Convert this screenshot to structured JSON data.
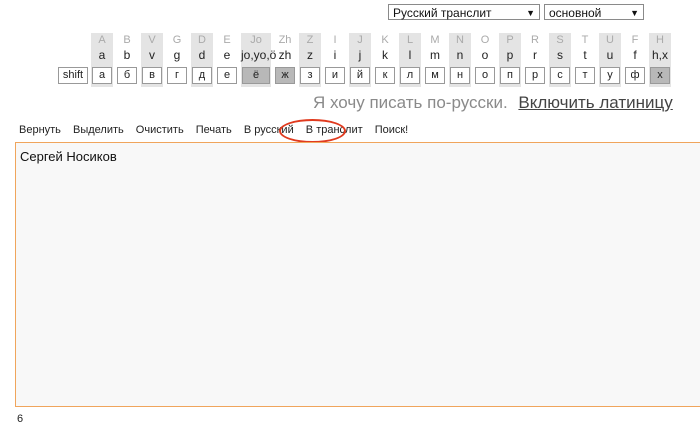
{
  "selects": {
    "mode": "Русский транслит",
    "layout": "основной"
  },
  "keyboard": {
    "columns": [
      {
        "upper": "A",
        "lower": "a",
        "key": "а",
        "shaded": true
      },
      {
        "upper": "B",
        "lower": "b",
        "key": "б",
        "shaded": false
      },
      {
        "upper": "V",
        "lower": "v",
        "key": "в",
        "shaded": true
      },
      {
        "upper": "G",
        "lower": "g",
        "key": "г",
        "shaded": false
      },
      {
        "upper": "D",
        "lower": "d",
        "key": "д",
        "shaded": true
      },
      {
        "upper": "E",
        "lower": "e",
        "key": "е",
        "shaded": false
      },
      {
        "upper": "Jo",
        "lower": "jo,yo,ö",
        "key": "ё",
        "shaded": true,
        "active": true,
        "wide": true
      },
      {
        "upper": "Zh",
        "lower": "zh",
        "key": "ж",
        "shaded": false,
        "active": true
      },
      {
        "upper": "Z",
        "lower": "z",
        "key": "з",
        "shaded": true
      },
      {
        "upper": "I",
        "lower": "i",
        "key": "и",
        "shaded": false
      },
      {
        "upper": "J",
        "lower": "j",
        "key": "й",
        "shaded": true
      },
      {
        "upper": "K",
        "lower": "k",
        "key": "к",
        "shaded": false
      },
      {
        "upper": "L",
        "lower": "l",
        "key": "л",
        "shaded": true
      },
      {
        "upper": "M",
        "lower": "m",
        "key": "м",
        "shaded": false
      },
      {
        "upper": "N",
        "lower": "n",
        "key": "н",
        "shaded": true
      },
      {
        "upper": "O",
        "lower": "o",
        "key": "о",
        "shaded": false
      },
      {
        "upper": "P",
        "lower": "p",
        "key": "п",
        "shaded": true
      },
      {
        "upper": "R",
        "lower": "r",
        "key": "р",
        "shaded": false
      },
      {
        "upper": "S",
        "lower": "s",
        "key": "с",
        "shaded": true
      },
      {
        "upper": "T",
        "lower": "t",
        "key": "т",
        "shaded": false
      },
      {
        "upper": "U",
        "lower": "u",
        "key": "у",
        "shaded": true
      },
      {
        "upper": "F",
        "lower": "f",
        "key": "ф",
        "shaded": false
      },
      {
        "upper": "H",
        "lower": "h,x",
        "key": "х",
        "shaded": true,
        "active": true
      }
    ],
    "shift_label": "shift"
  },
  "language": {
    "text": "Я хочу писать по-русски.",
    "link": "Включить латиницу"
  },
  "toolbar": {
    "items": [
      "Вернуть",
      "Выделить",
      "Очистить",
      "Печать",
      "В русский",
      "В транслит",
      "Поиск!"
    ],
    "highlight_color": "#e03a1e"
  },
  "editor": {
    "text": "Сергей Носиков",
    "border_color": "#f0a55c"
  },
  "counter": "6"
}
